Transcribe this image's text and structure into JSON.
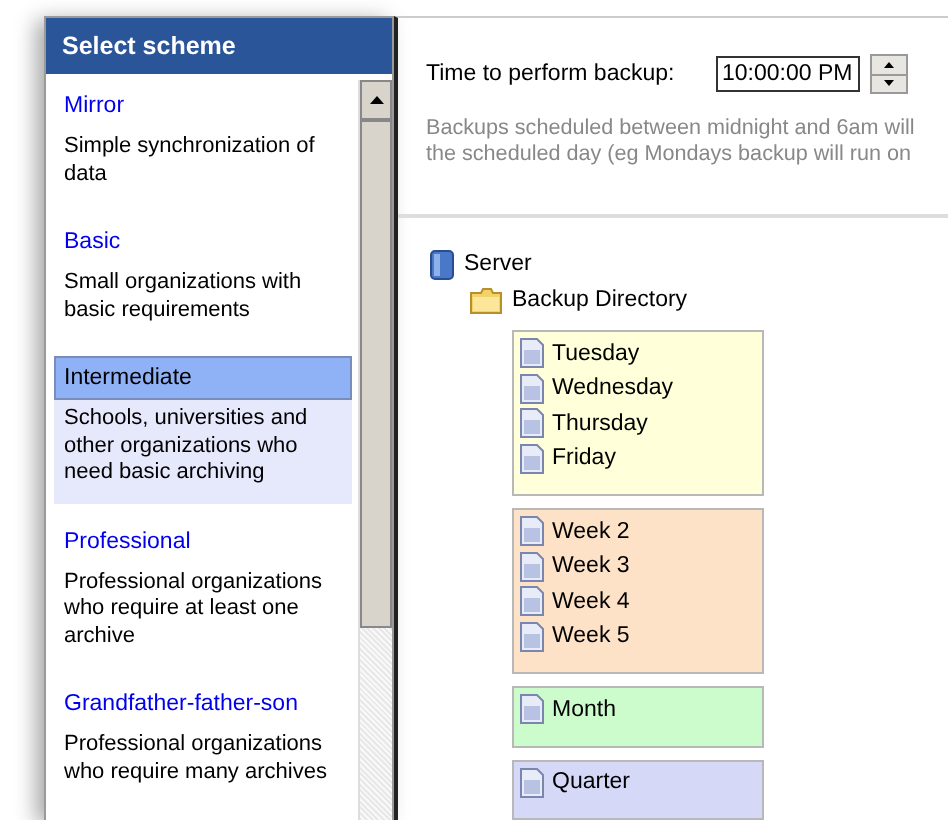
{
  "sidebar": {
    "title": "Select scheme",
    "items": [
      {
        "name": "Mirror",
        "description": "Simple synchronization of data",
        "selected": false
      },
      {
        "name": "Basic",
        "description": "Small organizations with basic requirements",
        "selected": false
      },
      {
        "name": "Intermediate",
        "description": "Schools, universities and other organizations who need basic archiving",
        "selected": true
      },
      {
        "name": "Professional",
        "description": "Professional organizations who require at least one archive",
        "selected": false
      },
      {
        "name": "Grandfather-father-son",
        "description": "Professional organizations who require many archives",
        "selected": false
      }
    ]
  },
  "schedule": {
    "label": "Time to perform backup:",
    "time": "10:00:00 PM",
    "note_lines": [
      "Backups scheduled between midnight and 6am will",
      "the scheduled day (eg Mondays backup will run on"
    ]
  },
  "tree": {
    "server": "Server",
    "folder": "Backup Directory",
    "groups": [
      {
        "color": "#ffffd9",
        "files": [
          "Tuesday",
          "Wednesday",
          "Thursday",
          "Friday"
        ]
      },
      {
        "color": "#fde2c8",
        "files": [
          "Week 2",
          "Week 3",
          "Week 4",
          "Week 5"
        ]
      },
      {
        "color": "#ccfccc",
        "files": [
          "Month"
        ]
      },
      {
        "color": "#d6d8f8",
        "files": [
          "Quarter"
        ]
      }
    ]
  }
}
